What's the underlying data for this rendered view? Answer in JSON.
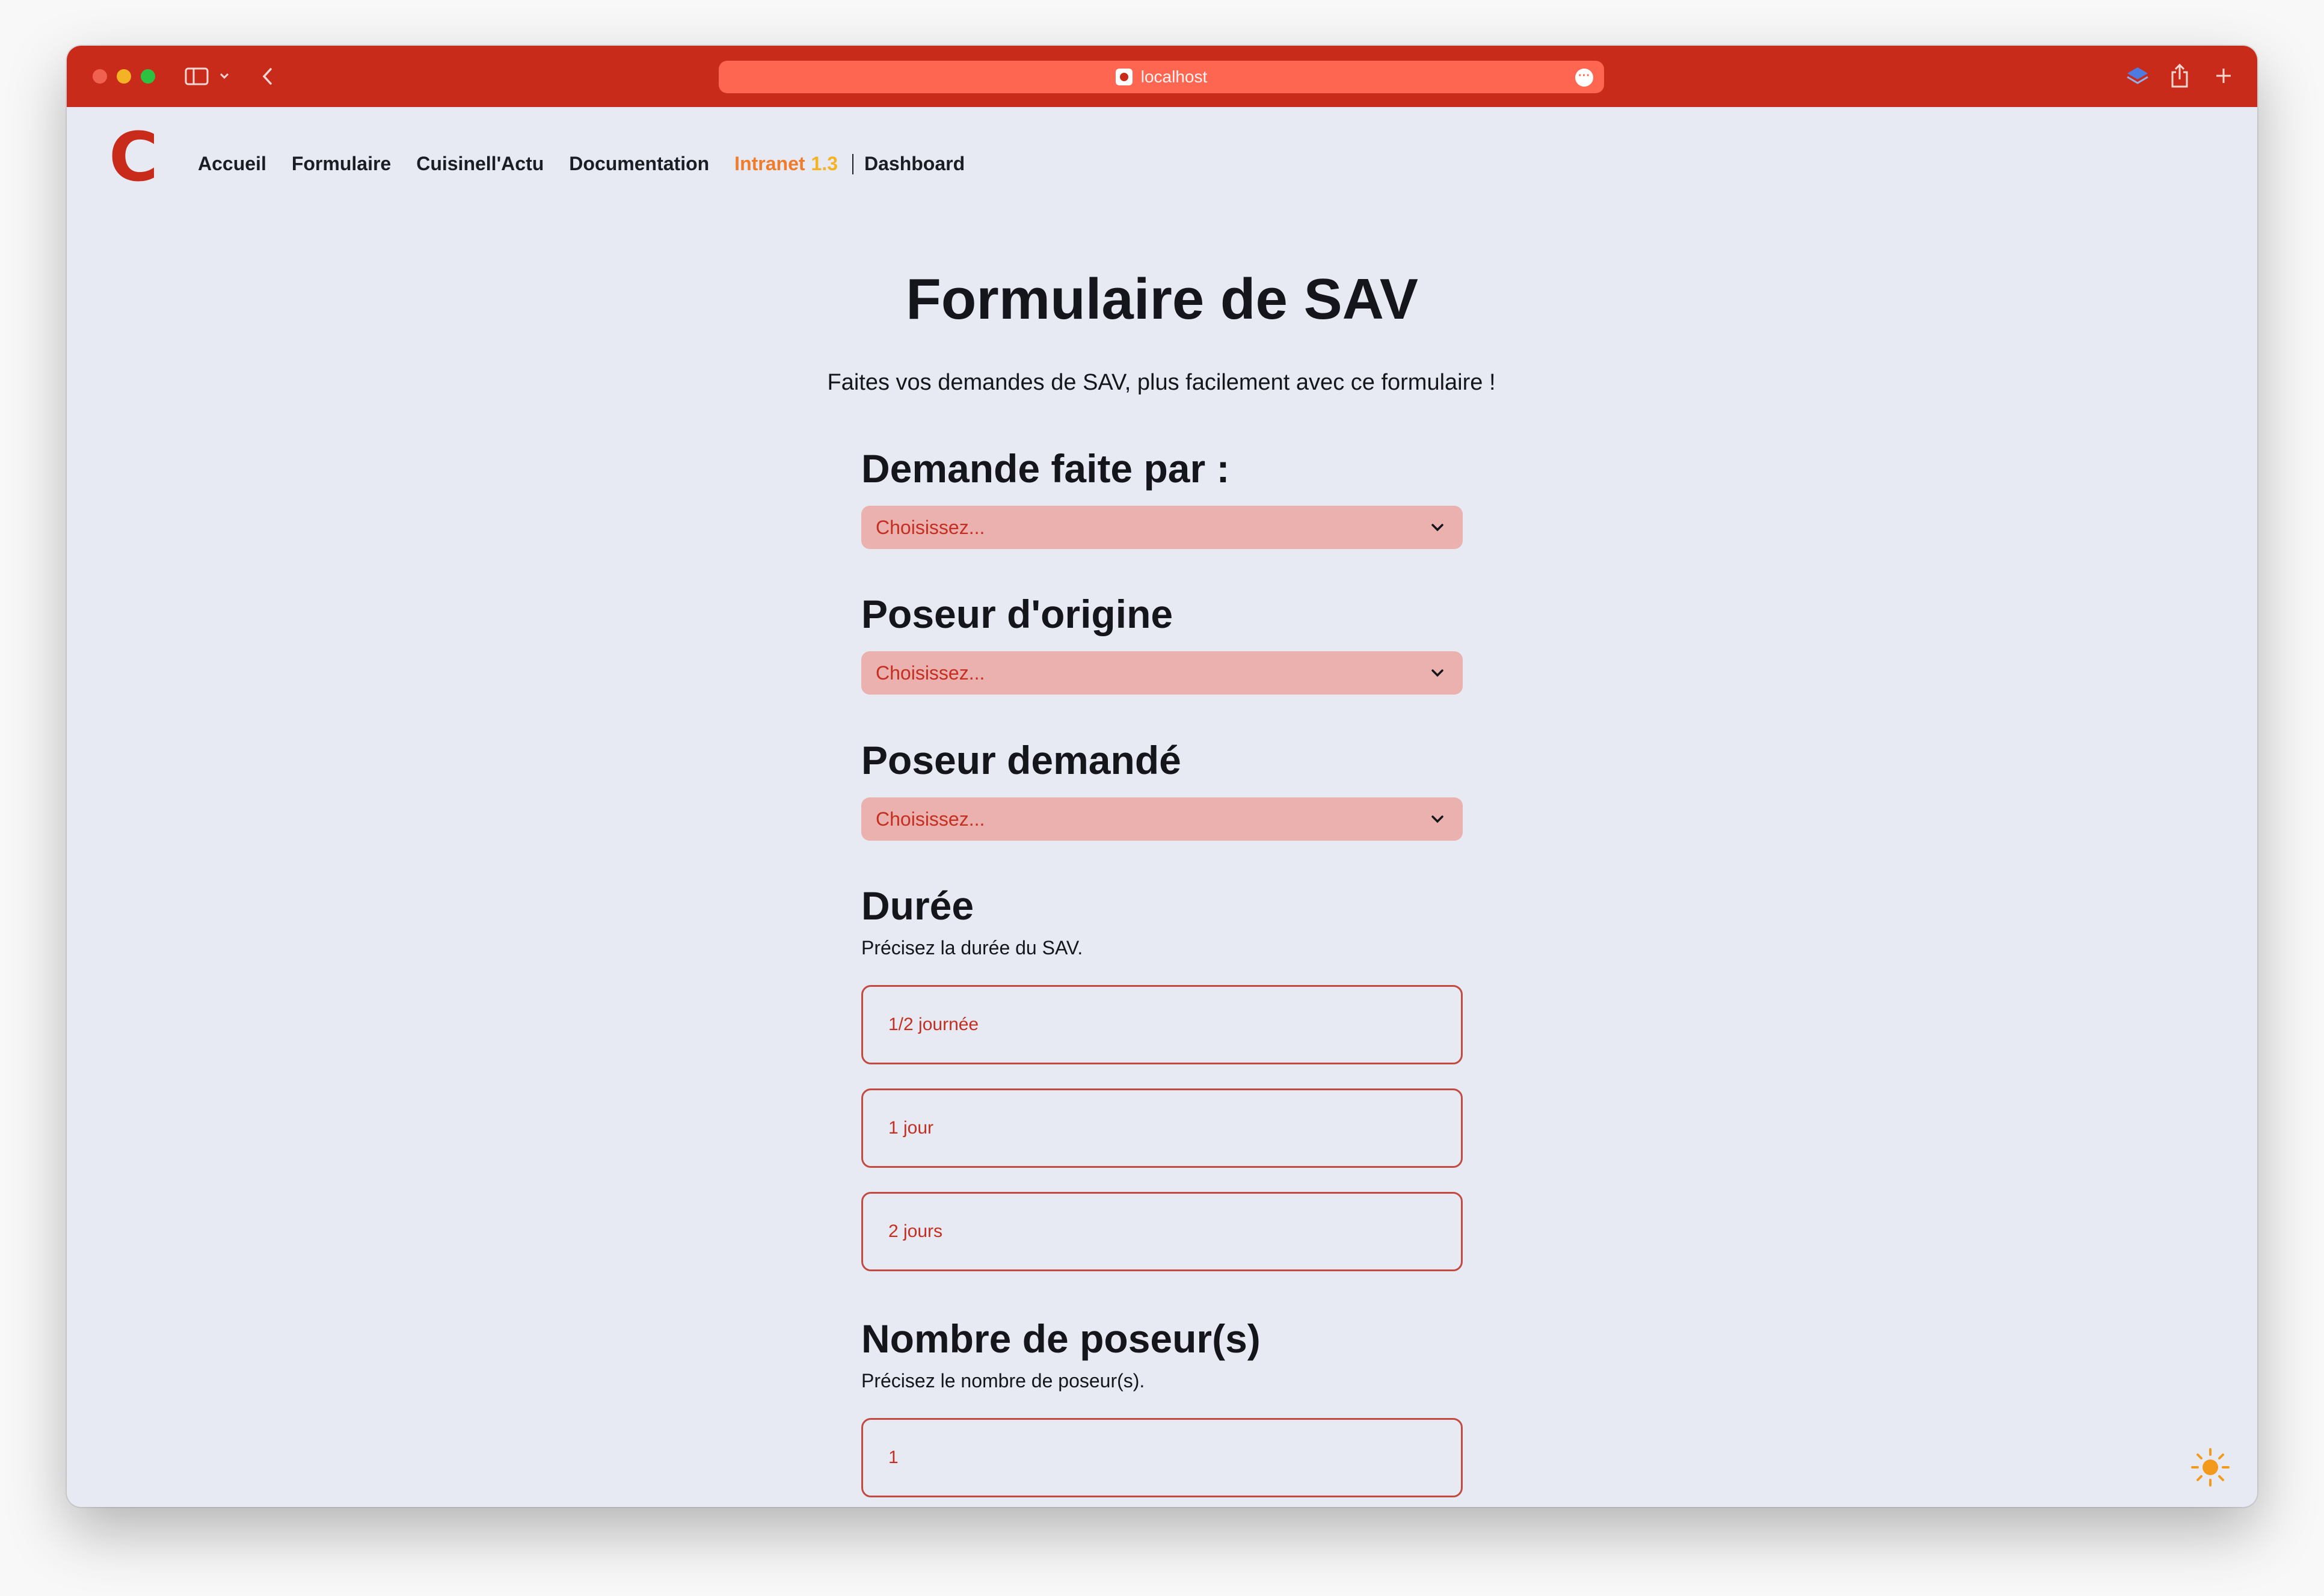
{
  "browser": {
    "url": "localhost"
  },
  "nav": {
    "logo": "C",
    "items": [
      "Accueil",
      "Formulaire",
      "Cuisinell'Actu",
      "Documentation"
    ],
    "intranet_label": "Intranet",
    "intranet_version": "1.3",
    "dashboard": "Dashboard"
  },
  "page": {
    "title": "Formulaire de SAV",
    "subtitle": "Faites vos demandes de SAV, plus facilement avec ce formulaire !"
  },
  "form": {
    "demande": {
      "label": "Demande faite par :",
      "placeholder": "Choisissez..."
    },
    "poseur_origine": {
      "label": "Poseur d'origine",
      "placeholder": "Choisissez..."
    },
    "poseur_demande": {
      "label": "Poseur demandé",
      "placeholder": "Choisissez..."
    },
    "duree": {
      "label": "Durée",
      "help": "Précisez la durée du SAV.",
      "options": [
        "1/2 journée",
        "1 jour",
        "2 jours"
      ]
    },
    "nombre": {
      "label": "Nombre de poseur(s)",
      "help": "Précisez le nombre de poseur(s).",
      "options": [
        "1"
      ]
    }
  },
  "colors": {
    "brand_red": "#c92b1b",
    "select_bg": "#ebb1ae",
    "accent_orange": "#f07b2a",
    "page_bg": "#e7eaf2"
  },
  "icons": [
    "sidebar-icon",
    "chevron-down-icon",
    "back-icon",
    "more-icon",
    "layers-icon",
    "share-icon",
    "plus-icon",
    "sun-icon"
  ]
}
